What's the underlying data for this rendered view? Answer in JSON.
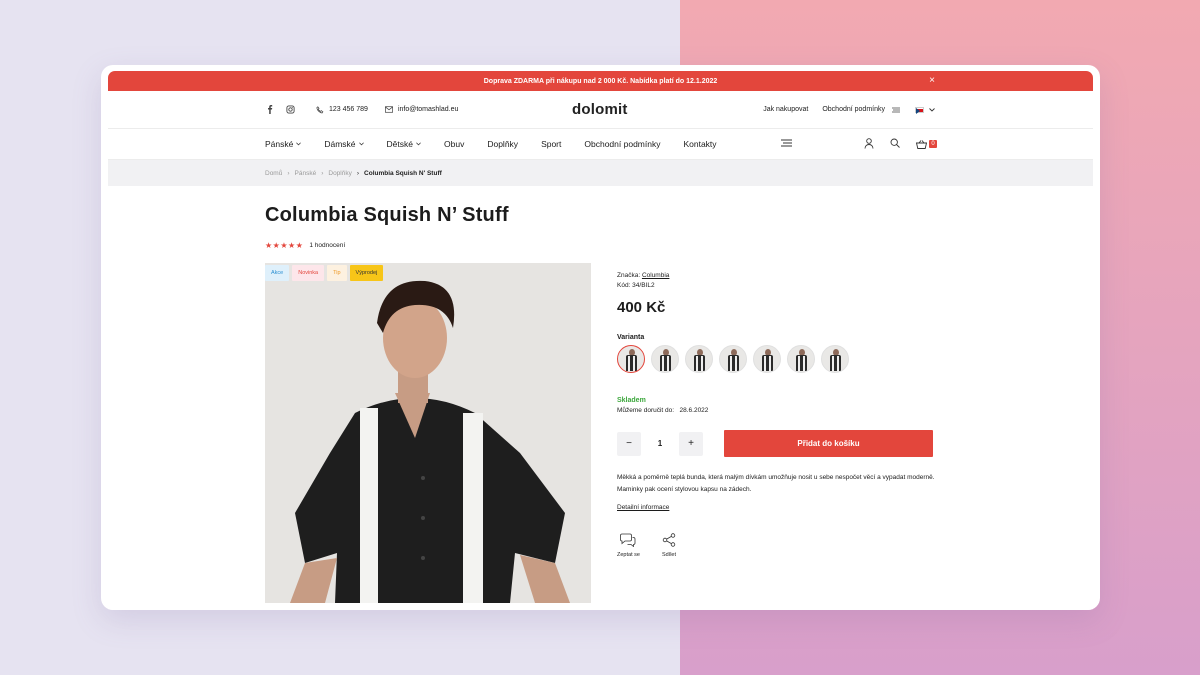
{
  "promo": {
    "text": "Doprava ZDARMA při nákupu nad 2 000 Kč. Nabídka platí do 12.1.2022",
    "close": "×"
  },
  "topbar": {
    "phone": "123 456 789",
    "email": "info@tomashlad.eu",
    "logo": "dolomit",
    "links": [
      "Jak nakupovat",
      "Obchodní podmínky"
    ]
  },
  "nav": {
    "items": [
      "Pánské",
      "Dámské",
      "Dětské",
      "Obuv",
      "Doplňky",
      "Sport",
      "Obchodní podmínky",
      "Kontakty"
    ],
    "cart_count": "0"
  },
  "breadcrumb": [
    "Domů",
    "Pánské",
    "Doplňky",
    "Columbia Squish N' Stuff"
  ],
  "product": {
    "title": "Columbia Squish N’ Stuff",
    "rating_text": "1 hodnocení",
    "stars": "★★★★★",
    "badges": [
      "Akce",
      "Novinka",
      "Tip",
      "Výprodej"
    ],
    "brand_label": "Značka:",
    "brand": "Columbia",
    "code": "Kód: 34/BIL2",
    "price": "400 Kč",
    "variant_label": "Varianta",
    "stock": "Skladem",
    "delivery": "Můžeme doručit do:   28.6.2022",
    "qty": "1",
    "minus": "−",
    "plus": "+",
    "add_to_cart": "Přidat do košíku",
    "description": "Měkká a poměrně teplá bunda, která malým dívkám umožňuje nosit u sebe nespočet věcí a vypadat moderně. Maminky pak ocení stylovou kapsu na zádech.",
    "detail_link": "Detailní informace",
    "actions": [
      "Zeptat se",
      "Sdílet"
    ]
  },
  "colors": {
    "accent": "#e3463c",
    "stock": "#3ca73c"
  }
}
